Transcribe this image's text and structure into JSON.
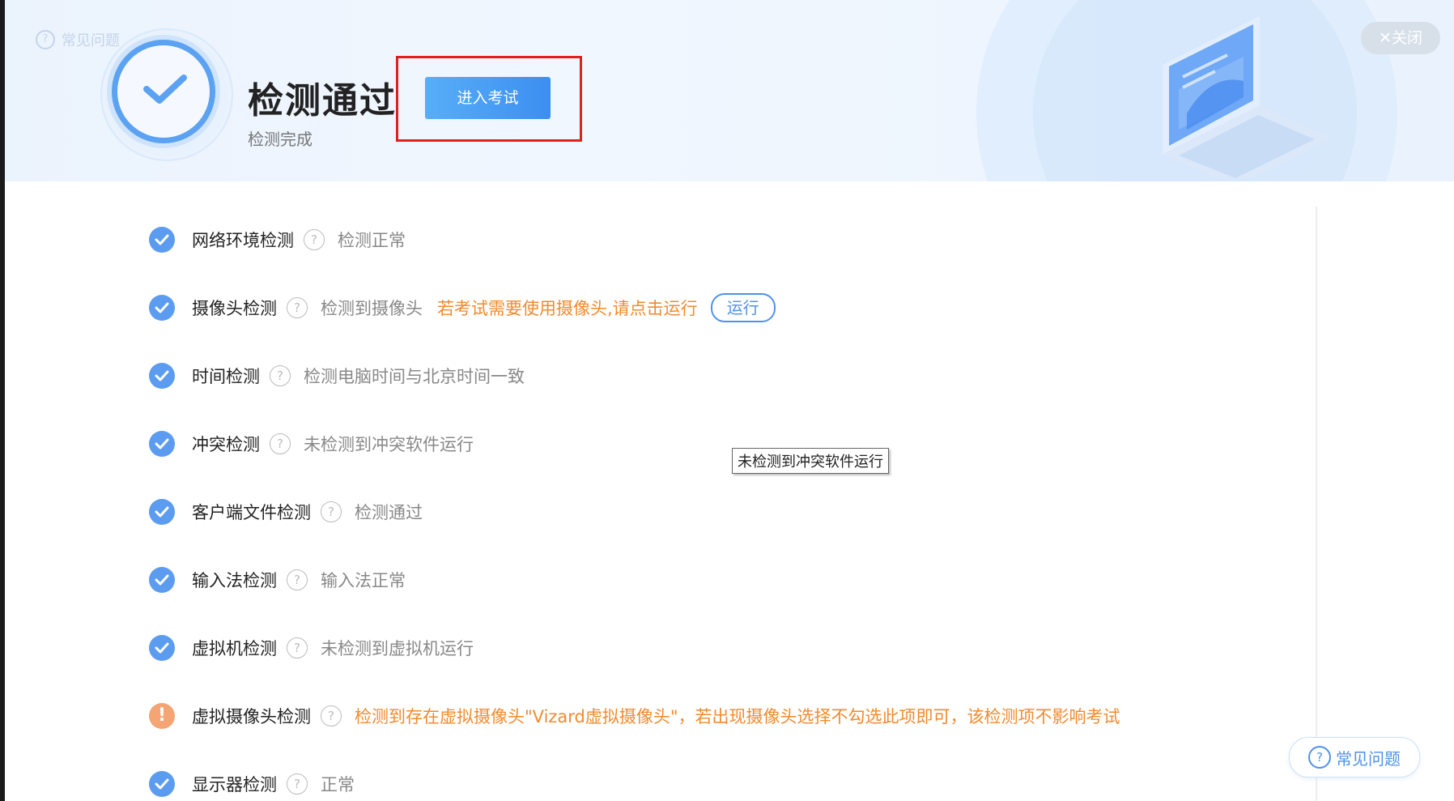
{
  "header": {
    "faq_ghost_label": "常见问题",
    "title": "检测通过",
    "subtitle": "检测完成",
    "enter_exam_label": "进入考试",
    "close_label": "✕关闭"
  },
  "items": [
    {
      "label": "网络环境检测",
      "status": "检测正常",
      "state": "ok"
    },
    {
      "label": "摄像头检测",
      "status": "检测到摄像头",
      "note": "若考试需要使用摄像头,请点击运行",
      "action": "运行",
      "state": "ok"
    },
    {
      "label": "时间检测",
      "status": "检测电脑时间与北京时间一致",
      "state": "ok"
    },
    {
      "label": "冲突检测",
      "status": "未检测到冲突软件运行",
      "state": "ok"
    },
    {
      "label": "客户端文件检测",
      "status": "检测通过",
      "state": "ok"
    },
    {
      "label": "输入法检测",
      "status": "输入法正常",
      "state": "ok"
    },
    {
      "label": "虚拟机检测",
      "status": "未检测到虚拟机运行",
      "state": "ok"
    },
    {
      "label": "虚拟摄像头检测",
      "status": "检测到存在虚拟摄像头\"Vizard虚拟摄像头\"，若出现摄像头选择不勾选此项即可，该检测项不影响考试",
      "state": "warning"
    },
    {
      "label": "显示器检测",
      "status": "正常",
      "state": "ok"
    }
  ],
  "help_glyph": "?",
  "warn_glyph": "!",
  "tooltip": "未检测到冲突软件运行",
  "faq_button_label": "常见问题",
  "colors": {
    "accent": "#5b9cf1",
    "warning": "#f28a2e",
    "highlight": "#e02020"
  }
}
